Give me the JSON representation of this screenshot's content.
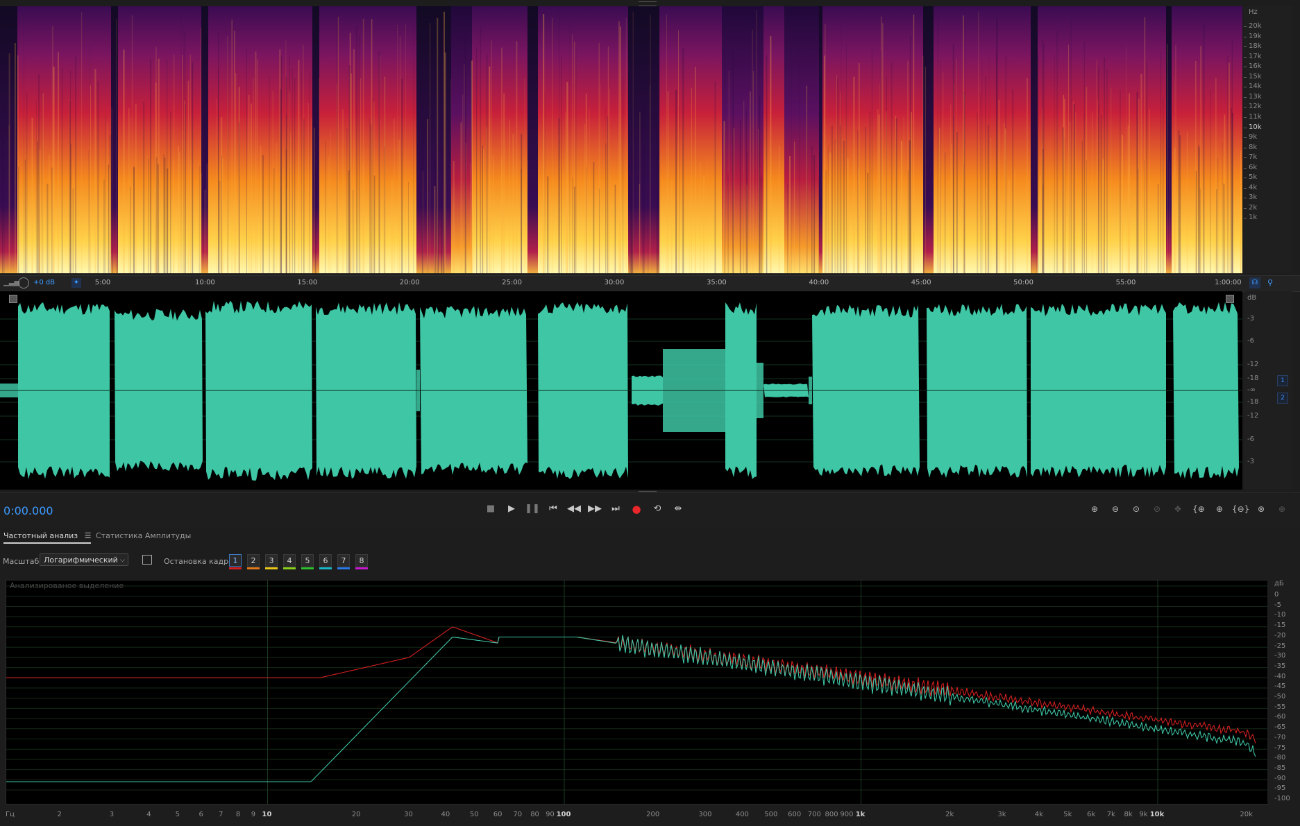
{
  "spectral": {
    "unit": "Hz",
    "labels": [
      "20k",
      "19k",
      "18k",
      "17k",
      "16k",
      "15k",
      "14k",
      "13k",
      "12k",
      "11k",
      "10k",
      "9k",
      "8k",
      "7k",
      "6k",
      "5k",
      "4k",
      "3k",
      "2k",
      "1k"
    ]
  },
  "ruler": {
    "gain": "+0 dB",
    "times": [
      "5:00",
      "10:00",
      "15:00",
      "20:00",
      "25:00",
      "30:00",
      "35:00",
      "40:00",
      "45:00",
      "50:00",
      "55:00",
      "1:00:00"
    ]
  },
  "waveform": {
    "unit": "dB",
    "labels_top": [
      "-3",
      "-6",
      "-12",
      "-18",
      "-∞"
    ],
    "labels_bottom": [
      "-18",
      "-12",
      "-6",
      "-3"
    ],
    "channels": [
      "1",
      "2"
    ],
    "color": "#3ec6a5"
  },
  "transport": {
    "timecode": "0:00.000",
    "icons": [
      "stop-icon",
      "play-icon",
      "pause-icon",
      "go-to-start-icon",
      "rewind-icon",
      "fast-forward-icon",
      "go-to-end-icon",
      "record-icon",
      "loop-icon",
      "skip-selection-icon"
    ]
  },
  "panel": {
    "tabs": [
      "Частотный анализ",
      "Статистика Амплитуды"
    ],
    "menu_icon": "hamburger-menu-icon",
    "scale_label": "Масштаб:",
    "scale_value": "Логарифмический",
    "freeze_label": "Остановка кадра:",
    "frames": [
      {
        "n": "1",
        "color": "#d42020"
      },
      {
        "n": "2",
        "color": "#e07a1c"
      },
      {
        "n": "3",
        "color": "#e8c81a"
      },
      {
        "n": "4",
        "color": "#8ad01a"
      },
      {
        "n": "5",
        "color": "#2ec02e"
      },
      {
        "n": "6",
        "color": "#1ab8c8"
      },
      {
        "n": "7",
        "color": "#2a7ae8"
      },
      {
        "n": "8",
        "color": "#c81ad0"
      }
    ]
  },
  "freq_graph": {
    "overlay_label": "Анализированое выделение",
    "db_unit": "дБ",
    "db_labels": [
      "0",
      "-5",
      "-10",
      "-15",
      "-20",
      "-25",
      "-30",
      "-35",
      "-40",
      "-45",
      "-50",
      "-55",
      "-60",
      "-65",
      "-70",
      "-75",
      "-80",
      "-85",
      "-90",
      "-95",
      "-100"
    ],
    "hz_unit": "Гц",
    "hz_labels": [
      "2",
      "3",
      "4",
      "5",
      "6",
      "7",
      "8",
      "9",
      "10",
      "20",
      "30",
      "40",
      "50",
      "60",
      "70",
      "80",
      "90",
      "100",
      "200",
      "300",
      "400",
      "500",
      "600",
      "700",
      "800",
      "900",
      "1k",
      "2k",
      "3k",
      "4k",
      "5k",
      "6k",
      "7k",
      "8k",
      "9k",
      "10k",
      "20k"
    ],
    "series_colors": [
      "#d42020",
      "#3ec6a5"
    ]
  }
}
